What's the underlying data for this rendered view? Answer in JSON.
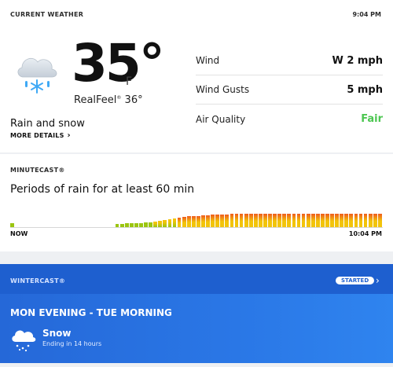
{
  "current_weather": {
    "heading": "CURRENT WEATHER",
    "time": "9:04 PM",
    "icon": "cloud-rain-snow-icon",
    "temperature": "35°",
    "unit": "F",
    "realfeel_label": "RealFeel",
    "realfeel_tm": "®",
    "realfeel_value": "36°",
    "condition": "Rain and snow",
    "more_details": "MORE DETAILS",
    "details": [
      {
        "label": "Wind",
        "value": "W 2 mph"
      },
      {
        "label": "Wind Gusts",
        "value": "5 mph"
      },
      {
        "label": "Air Quality",
        "value": "Fair"
      }
    ]
  },
  "minutecast": {
    "heading": "MINUTECAST®",
    "description": "Periods of rain for at least 60 min",
    "start_label": "NOW",
    "end_label": "10:04 PM",
    "intensity": [
      0.3,
      0,
      0,
      0,
      0,
      0,
      0,
      0,
      0,
      0,
      0,
      0,
      0,
      0,
      0,
      0,
      0,
      0,
      0,
      0,
      0,
      0,
      0.2,
      0.2,
      0.25,
      0.25,
      0.3,
      0.3,
      0.35,
      0.35,
      0.4,
      0.45,
      0.5,
      0.55,
      0.6,
      0.65,
      0.7,
      0.75,
      0.8,
      0.8,
      0.85,
      0.85,
      0.9,
      0.9,
      0.9,
      0.9,
      0.95,
      0.95,
      0.95,
      0.95,
      0.95,
      0.95,
      0.95,
      0.95,
      0.95,
      0.95,
      0.95,
      0.95,
      0.95,
      0.95,
      0.95,
      0.95,
      0.95,
      0.95,
      0.95,
      0.95,
      0.95,
      0.95,
      0.95,
      0.95,
      0.95,
      0.95,
      0.95,
      0.95,
      0.95,
      0.95,
      0.95,
      0.95
    ],
    "colors": {
      "light": "#9bc511",
      "mid": "#f2c40a",
      "heavy": "#ef5a1d"
    }
  },
  "wintercast": {
    "heading": "WINTERCAST®",
    "badge": "STARTED",
    "period": "MON EVENING - TUE MORNING",
    "icon": "cloud-snow-icon",
    "condition": "Snow",
    "sub": "Ending in 14 hours"
  }
}
